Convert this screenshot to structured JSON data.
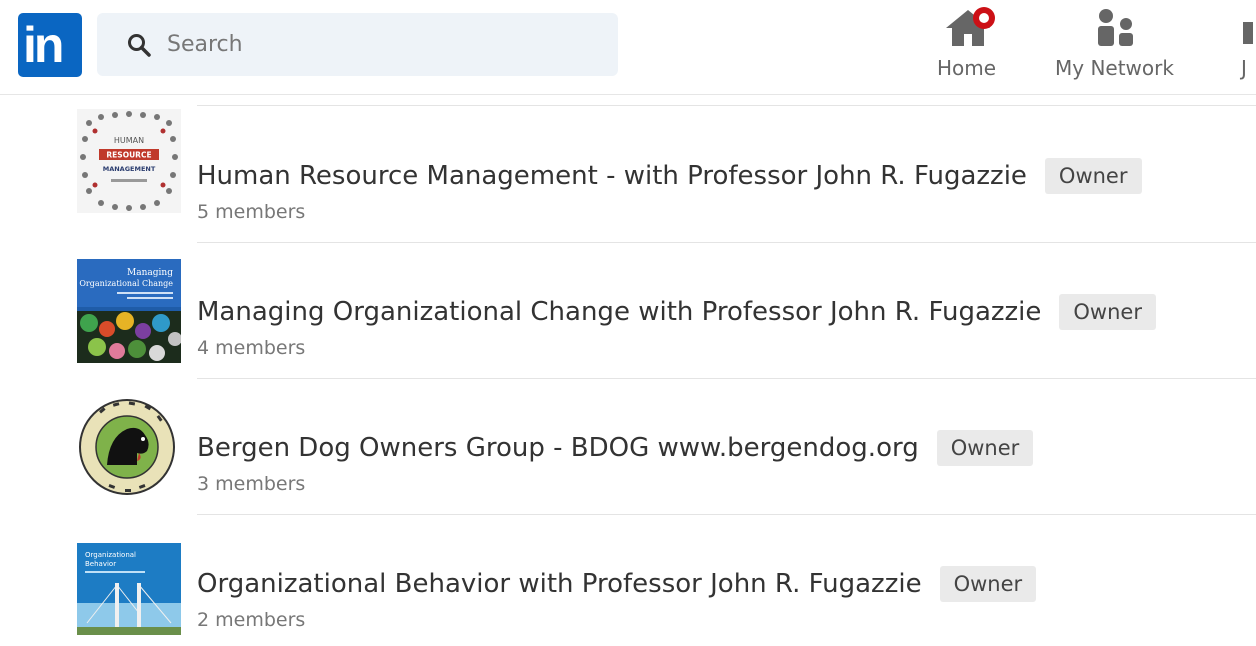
{
  "header": {
    "logo_text": "in",
    "search": {
      "placeholder": "Search"
    },
    "nav": [
      {
        "label": "Home",
        "icon": "home-icon",
        "notification": true
      },
      {
        "label": "My Network",
        "icon": "people-icon"
      },
      {
        "label": "J",
        "icon": "briefcase-icon"
      }
    ]
  },
  "groups": [
    {
      "title": "Human Resource Management - with Professor John R. Fugazzie",
      "badge": "Owner",
      "members": "5 members",
      "thumb_text": [
        "HUMAN",
        "RESOURCE",
        "MANAGEMENT"
      ]
    },
    {
      "title": "Managing Organizational Change with Professor John R. Fugazzie",
      "badge": "Owner",
      "members": "4 members",
      "thumb_text": [
        "Managing",
        "Organizational Change"
      ]
    },
    {
      "title": "Bergen Dog Owners Group - BDOG www.bergendog.org",
      "badge": "Owner",
      "members": "3 members"
    },
    {
      "title": "Organizational Behavior with Professor John R. Fugazzie",
      "badge": "Owner",
      "members": "2 members",
      "thumb_text": [
        "Organizational",
        "Behavior"
      ]
    }
  ],
  "colors": {
    "brand": "#0a66c2",
    "notification": "#cc1016",
    "badge_bg": "#eaeaea",
    "search_bg": "#eef3f8"
  }
}
